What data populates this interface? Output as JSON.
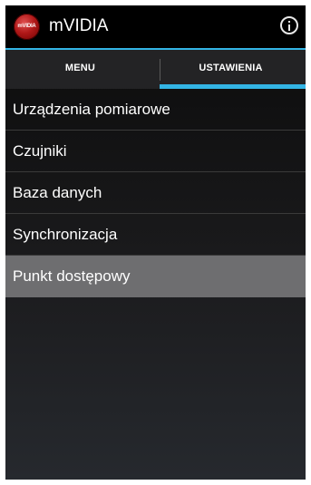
{
  "app": {
    "logo_text": "mVIDIA",
    "title": "mVIDIA",
    "info_icon": "info-icon"
  },
  "tabs": [
    {
      "label": "MENU",
      "selected": false
    },
    {
      "label": "USTAWIENIA",
      "selected": true
    }
  ],
  "settings_list": [
    {
      "label": "Urządzenia pomiarowe"
    },
    {
      "label": "Czujniki"
    },
    {
      "label": "Baza danych"
    },
    {
      "label": "Synchronizacja"
    },
    {
      "label": "Punkt dostępowy",
      "selected": true
    }
  ],
  "colors": {
    "accent": "#33b5e5",
    "selected_row": "#6e6e70",
    "logo": "#b01818"
  }
}
